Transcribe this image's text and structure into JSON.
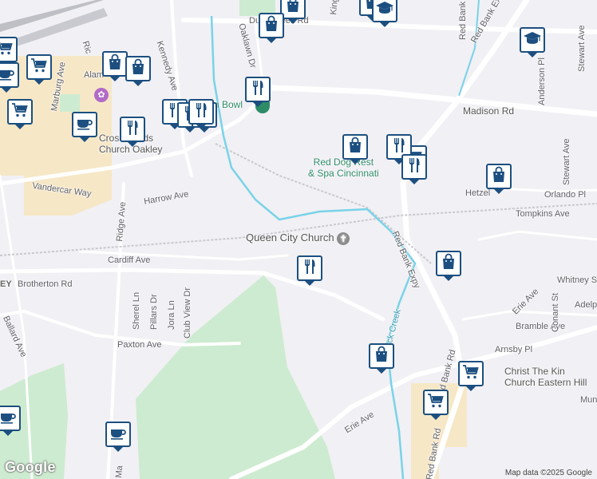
{
  "map": {
    "attribution": "Map data ©2025 Google",
    "logo_text": "Google",
    "colors": {
      "background": "#f1f0f4",
      "park": "#cdebd0",
      "commercial": "#f6e7c6",
      "water": "#79d3e8",
      "road": "#ffffff",
      "marker_border": "#1c4f80"
    }
  },
  "streets": [
    {
      "id": "madison-rd",
      "label": "Madison Rd"
    },
    {
      "id": "red-bank-expy-top",
      "label": "Red Bank Expy"
    },
    {
      "id": "red-bank-expy-mid",
      "label": "Red Bank Expy"
    },
    {
      "id": "red-bank-rd",
      "label": "Red Bank Rd"
    },
    {
      "id": "red-bank-rd-bottom",
      "label": "Red Bank Rd"
    },
    {
      "id": "red-bank-top",
      "label": "Red Bank"
    },
    {
      "id": "stewart-ave-top",
      "label": "Stewart Ave"
    },
    {
      "id": "stewart-ave",
      "label": "Stewart Ave"
    },
    {
      "id": "anderson-pl",
      "label": "Anderson Pl"
    },
    {
      "id": "orlando-pl",
      "label": "Orlando Pl"
    },
    {
      "id": "tompkins-ave",
      "label": "Tompkins Ave"
    },
    {
      "id": "hetzel",
      "label": "Hetzel"
    },
    {
      "id": "cardiff-ave",
      "label": "Cardiff Ave"
    },
    {
      "id": "brotherton-rd",
      "label": "Brotherton Rd"
    },
    {
      "id": "ridge-ave",
      "label": "Ridge Ave"
    },
    {
      "id": "harrow-ave",
      "label": "Harrow Ave"
    },
    {
      "id": "vandercar-way",
      "label": "Vandercar Way"
    },
    {
      "id": "kennedy-ave",
      "label": "Kennedy Ave"
    },
    {
      "id": "marburg-ave",
      "label": "Marburg Ave"
    },
    {
      "id": "oaklawn-dr",
      "label": "Oaklawn Dr"
    },
    {
      "id": "duck-creek-rd",
      "label": "Duck Creek Rd"
    },
    {
      "id": "sherel-ln",
      "label": "Sherel Ln"
    },
    {
      "id": "pillars-dr",
      "label": "Pillars Dr"
    },
    {
      "id": "jora-ln",
      "label": "Jora Ln"
    },
    {
      "id": "club-view-dr",
      "label": "Club View Dr"
    },
    {
      "id": "paxton-ave",
      "label": "Paxton Ave"
    },
    {
      "id": "ballard-ave",
      "label": "Ballard Ave"
    },
    {
      "id": "erie-ave",
      "label": "Erie Ave"
    },
    {
      "id": "erie-ave-east",
      "label": "Erie Ave"
    },
    {
      "id": "bramble-ave",
      "label": "Bramble Ave"
    },
    {
      "id": "arnsby-pl",
      "label": "Arnsby Pl"
    },
    {
      "id": "whitney-st",
      "label": "Whitney St"
    },
    {
      "id": "conant-st",
      "label": "Conant St"
    },
    {
      "id": "adelphi",
      "label": "Adelp"
    },
    {
      "id": "duck-creek",
      "label": "ck Creek"
    },
    {
      "id": "alam",
      "label": "Alam"
    },
    {
      "id": "ric",
      "label": "Ric"
    },
    {
      "id": "kin",
      "label": "King"
    },
    {
      "id": "mun",
      "label": "Mun"
    },
    {
      "id": "ey",
      "label": "EY"
    },
    {
      "id": "ma",
      "label": "Ma"
    }
  ],
  "places": {
    "queen_city_church": "Queen City Church",
    "red_dog": [
      "Red Dog Pet Resort",
      "& Spa Cincinnati"
    ],
    "red_dog_visible": [
      "Red Dog",
      "Rest",
      "& Spa Cincinnati"
    ],
    "crossroads": [
      "Cros",
      "ads",
      "Church Oakley"
    ],
    "christ_the_king": [
      "Christ The Kin",
      "Church Eastern Hill"
    ],
    "bowl": "n Bowl"
  },
  "markers": [
    {
      "type": "shopping-bag"
    },
    {
      "type": "shopping-bag"
    },
    {
      "type": "shopping-bag"
    },
    {
      "type": "shopping-bag"
    },
    {
      "type": "shopping-bag"
    },
    {
      "type": "shopping-bag"
    },
    {
      "type": "shopping-bag"
    },
    {
      "type": "shopping-bag"
    },
    {
      "type": "shopping-bag"
    },
    {
      "type": "cart"
    },
    {
      "type": "cart"
    },
    {
      "type": "cart"
    },
    {
      "type": "cart"
    },
    {
      "type": "cart"
    },
    {
      "type": "cart"
    },
    {
      "type": "restaurant"
    },
    {
      "type": "restaurant"
    },
    {
      "type": "restaurant"
    },
    {
      "type": "restaurant"
    },
    {
      "type": "restaurant"
    },
    {
      "type": "restaurant"
    },
    {
      "type": "restaurant"
    },
    {
      "type": "restaurant"
    },
    {
      "type": "restaurant"
    },
    {
      "type": "cafe"
    },
    {
      "type": "cafe"
    },
    {
      "type": "cafe"
    },
    {
      "type": "cafe"
    },
    {
      "type": "school"
    },
    {
      "type": "school"
    }
  ]
}
